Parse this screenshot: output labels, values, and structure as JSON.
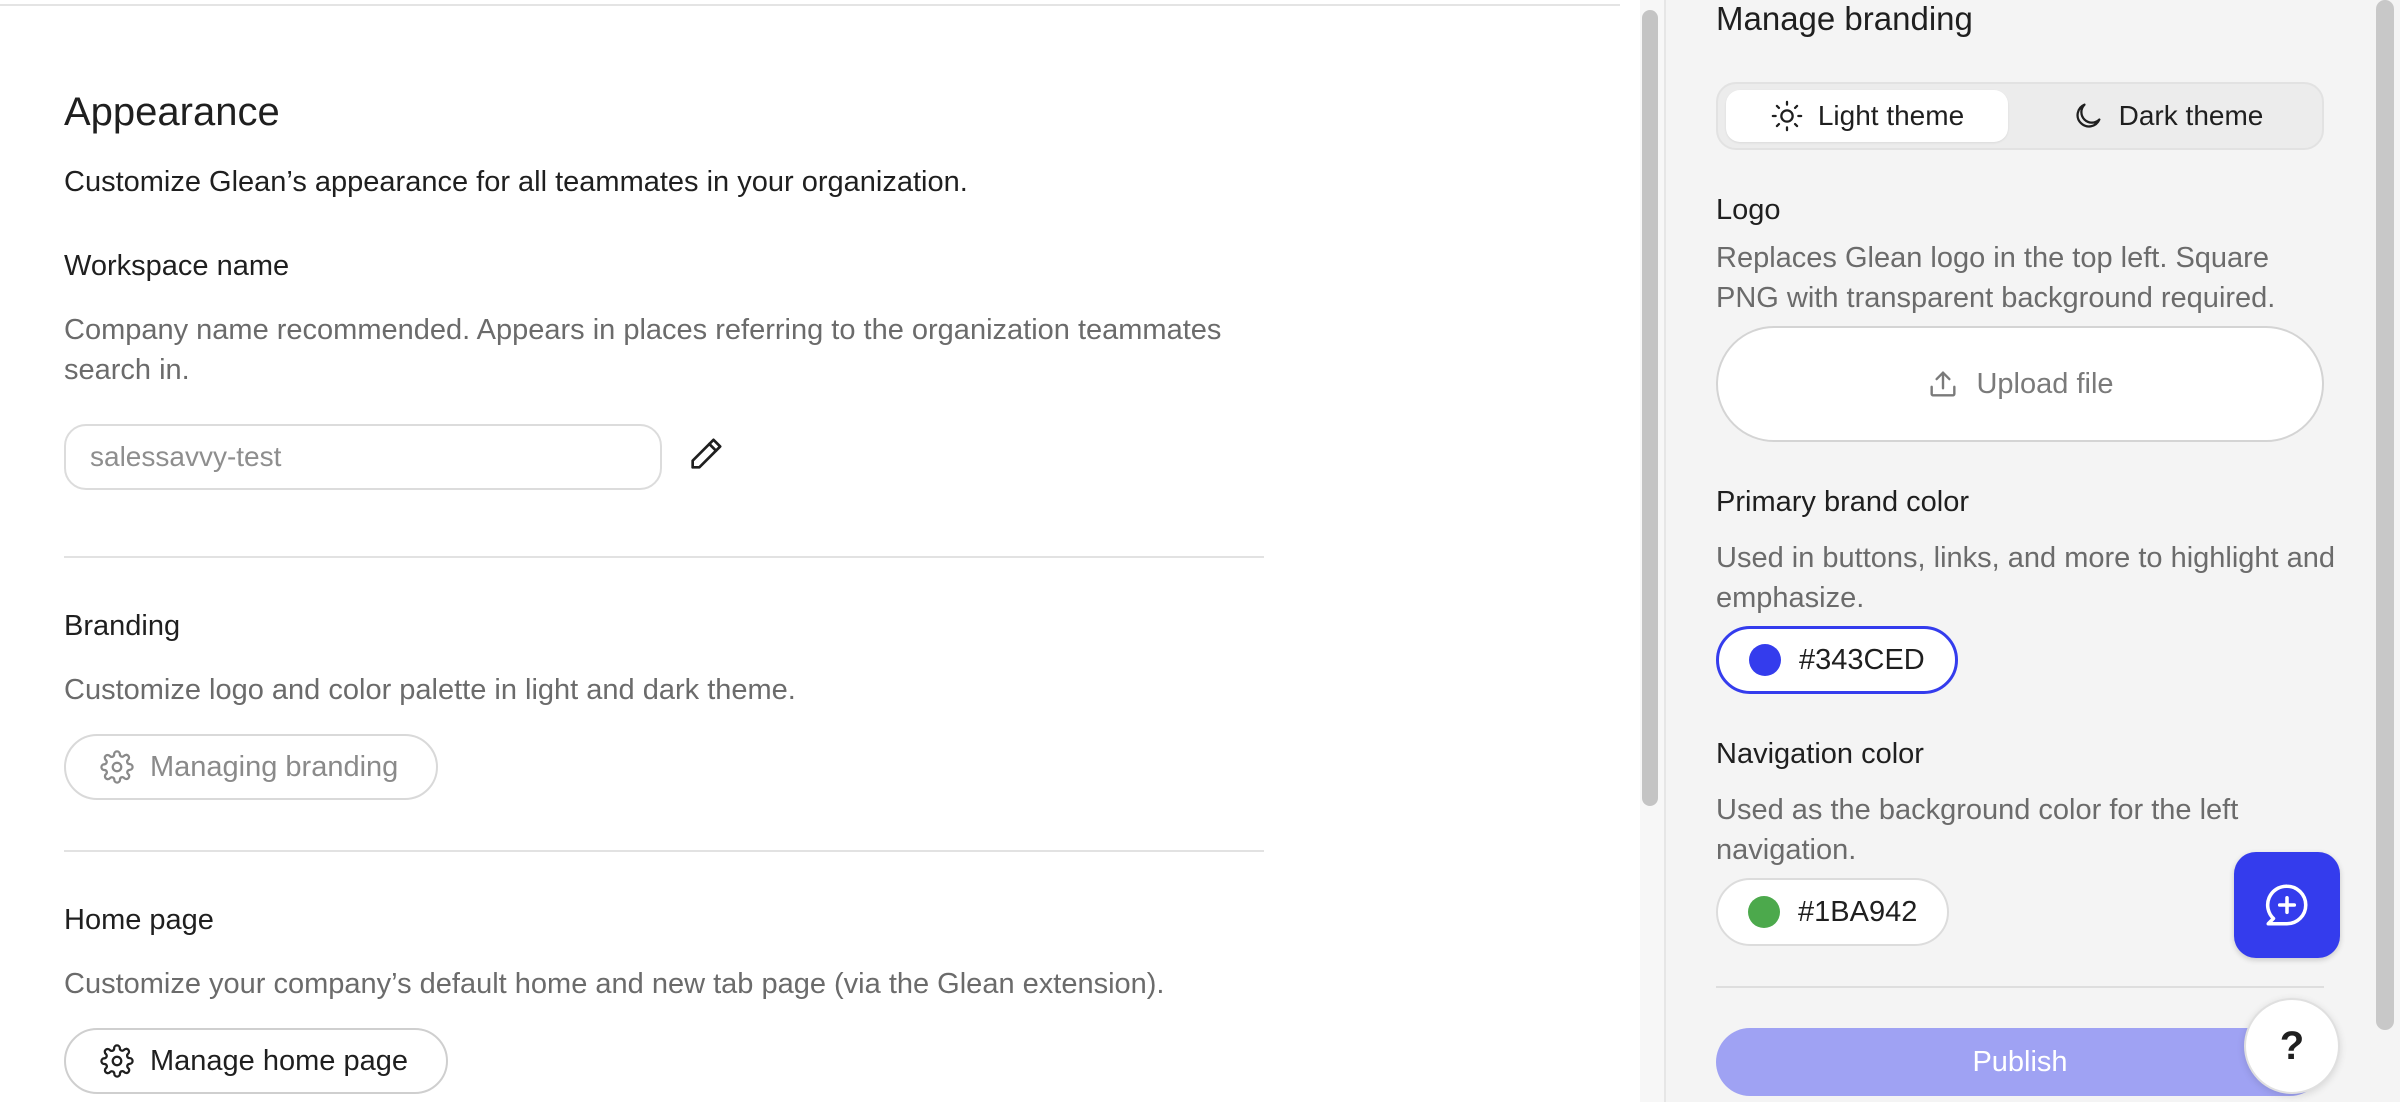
{
  "appearance": {
    "title": "Appearance",
    "subtitle": "Customize Glean’s appearance for all teammates in your organization.",
    "workspace": {
      "label": "Workspace name",
      "description": "Company name recommended. Appears in places referring to the organization teammates search in.",
      "value": "salessavvy-test"
    },
    "branding": {
      "label": "Branding",
      "description": "Customize logo and color palette in light and dark theme.",
      "button_label": "Managing branding"
    },
    "home_page": {
      "label": "Home page",
      "description": "Customize your company’s default home and new tab page (via the Glean extension).",
      "button_label": "Manage home page"
    }
  },
  "panel": {
    "title": "Manage branding",
    "themes": {
      "light": "Light theme",
      "dark": "Dark theme",
      "selected": "light"
    },
    "logo": {
      "label": "Logo",
      "description": "Replaces Glean logo in the top left. Square PNG with transparent background required.",
      "upload_label": "Upload file"
    },
    "primary_color": {
      "label": "Primary brand color",
      "description": "Used in buttons, links, and more to highlight and emphasize.",
      "value": "#343CED",
      "swatch": "#343CED"
    },
    "nav_color": {
      "label": "Navigation color",
      "description": "Used as the background color for the left navigation.",
      "value": "#1BA942",
      "swatch": "#4CA94C"
    },
    "publish_label": "Publish"
  },
  "help": {
    "label": "?"
  },
  "colors": {
    "accent": "#343CED",
    "publish_disabled": "#9FA2F3"
  },
  "icons": [
    "pencil-icon",
    "gear-icon",
    "sun-icon",
    "moon-icon",
    "upload-icon",
    "chat-sparkle-icon"
  ]
}
